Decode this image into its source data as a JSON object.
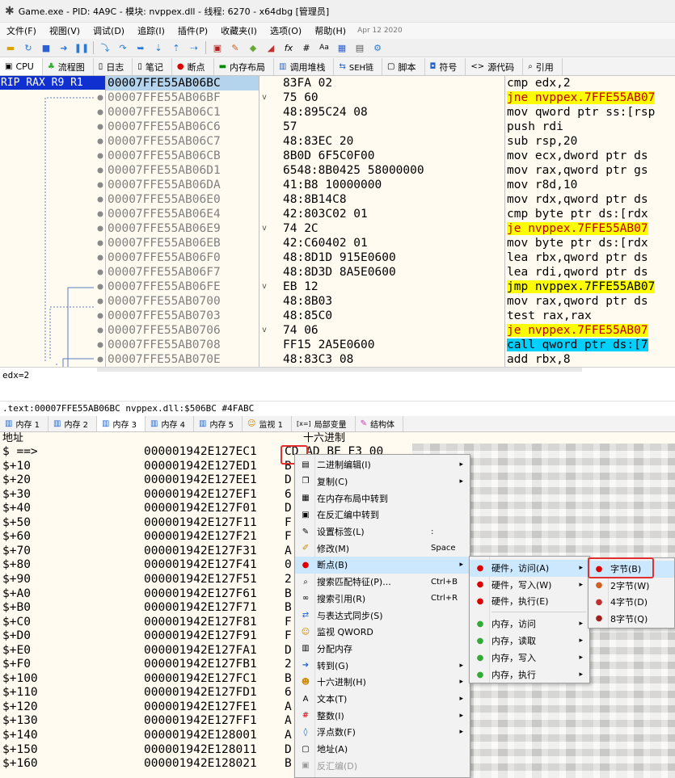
{
  "window": {
    "title": "Game.exe - PID: 4A9C - 模块: nvppex.dll - 线程: 6270 - x64dbg [管理员]"
  },
  "menubar": {
    "items": [
      "文件(F)",
      "视图(V)",
      "调试(D)",
      "追踪(I)",
      "插件(P)",
      "收藏夹(I)",
      "选项(O)",
      "帮助(H)"
    ],
    "date": "Apr 12 2020"
  },
  "cpu_tabs": [
    {
      "label": "CPU",
      "icon": "cpu-icon"
    },
    {
      "label": "流程图",
      "icon": "graph-icon"
    },
    {
      "label": "日志",
      "icon": "log-icon"
    },
    {
      "label": "笔记",
      "icon": "notes-icon"
    },
    {
      "label": "断点",
      "icon": "breakpoint-icon"
    },
    {
      "label": "内存布局",
      "icon": "memory-map-icon"
    },
    {
      "label": "调用堆栈",
      "icon": "callstack-icon"
    },
    {
      "label": "SEH链",
      "icon": "seh-icon"
    },
    {
      "label": "脚本",
      "icon": "script-icon"
    },
    {
      "label": "符号",
      "icon": "symbols-icon"
    },
    {
      "label": "源代码",
      "icon": "source-icon"
    },
    {
      "label": "引用",
      "icon": "references-icon"
    }
  ],
  "registers_label": "RIP RAX R9 R1",
  "disasm": [
    {
      "addr": "00007FFE55AB06BC",
      "bytes": "83FA 02",
      "instr": "cmp edx,2",
      "arrow": "",
      "hl": ""
    },
    {
      "addr": "00007FFE55AB06BF",
      "bytes": "75 60",
      "instr": "jne nvppex.7FFE55AB07",
      "arrow": "v",
      "hl": "jcc"
    },
    {
      "addr": "00007FFE55AB06C1",
      "bytes": "48:895C24 08",
      "instr": "mov qword ptr ss:[rsp",
      "arrow": "",
      "hl": ""
    },
    {
      "addr": "00007FFE55AB06C6",
      "bytes": "57",
      "instr": "push rdi",
      "arrow": "",
      "hl": ""
    },
    {
      "addr": "00007FFE55AB06C7",
      "bytes": "48:83EC 20",
      "instr": "sub rsp,20",
      "arrow": "",
      "hl": ""
    },
    {
      "addr": "00007FFE55AB06CB",
      "bytes": "8B0D 6F5C0F00",
      "instr": "mov ecx,dword ptr ds",
      "arrow": "",
      "hl": ""
    },
    {
      "addr": "00007FFE55AB06D1",
      "bytes": "6548:8B0425 58000000",
      "instr": "mov rax,qword ptr gs",
      "arrow": "",
      "hl": ""
    },
    {
      "addr": "00007FFE55AB06DA",
      "bytes": "41:B8 10000000",
      "instr": "mov r8d,10",
      "arrow": "",
      "hl": ""
    },
    {
      "addr": "00007FFE55AB06E0",
      "bytes": "48:8B14C8",
      "instr": "mov rdx,qword ptr ds",
      "arrow": "",
      "hl": ""
    },
    {
      "addr": "00007FFE55AB06E4",
      "bytes": "42:803C02 01",
      "instr": "cmp byte ptr ds:[rdx",
      "arrow": "",
      "hl": ""
    },
    {
      "addr": "00007FFE55AB06E9",
      "bytes": "74 2C",
      "instr": "je nvppex.7FFE55AB07",
      "arrow": "v",
      "hl": "jcc"
    },
    {
      "addr": "00007FFE55AB06EB",
      "bytes": "42:C60402 01",
      "instr": "mov byte ptr ds:[rdx",
      "arrow": "",
      "hl": ""
    },
    {
      "addr": "00007FFE55AB06F0",
      "bytes": "48:8D1D 915E0600",
      "instr": "lea rbx,qword ptr ds",
      "arrow": "",
      "hl": ""
    },
    {
      "addr": "00007FFE55AB06F7",
      "bytes": "48:8D3D 8A5E0600",
      "instr": "lea rdi,qword ptr ds",
      "arrow": "",
      "hl": ""
    },
    {
      "addr": "00007FFE55AB06FE",
      "bytes": "EB 12",
      "instr": "jmp nvppex.7FFE55AB07",
      "arrow": "v",
      "hl": "jmp"
    },
    {
      "addr": "00007FFE55AB0700",
      "bytes": "48:8B03",
      "instr": "mov rax,qword ptr ds",
      "arrow": "",
      "hl": ""
    },
    {
      "addr": "00007FFE55AB0703",
      "bytes": "48:85C0",
      "instr": "test rax,rax",
      "arrow": "",
      "hl": ""
    },
    {
      "addr": "00007FFE55AB0706",
      "bytes": "74 06",
      "instr": "je nvppex.7FFE55AB07",
      "arrow": "v",
      "hl": "jcc"
    },
    {
      "addr": "00007FFE55AB0708",
      "bytes": "FF15 2A5E0600",
      "instr": "call qword ptr ds:[7",
      "arrow": "",
      "hl": "call"
    },
    {
      "addr": "00007FFE55AB070E",
      "bytes": "48:83C3 08",
      "instr": "add rbx,8",
      "arrow": "",
      "hl": ""
    }
  ],
  "info_line": "edx=2",
  "location_line": ".text:00007FFE55AB06BC nvppex.dll:$506BC #4FABC",
  "dump_tabs": [
    {
      "label": "内存 1",
      "icon": "dump-icon"
    },
    {
      "label": "内存 2",
      "icon": "dump-icon"
    },
    {
      "label": "内存 3",
      "icon": "dump-icon"
    },
    {
      "label": "内存 4",
      "icon": "dump-icon"
    },
    {
      "label": "内存 5",
      "icon": "dump-icon"
    },
    {
      "label": "监视 1",
      "icon": "watch-icon"
    },
    {
      "label": "局部变量",
      "icon": "locals-icon"
    },
    {
      "label": "结构体",
      "icon": "struct-icon"
    }
  ],
  "dump_header": {
    "addr_col": "地址",
    "hex_col": "十六进制"
  },
  "dump_rows": [
    {
      "off": "$ ==>",
      "addr": "000001942E127EC1",
      "hex": "CD AD BE E3 00"
    },
    {
      "off": "$+10",
      "addr": "000001942E127ED1",
      "hex": "B"
    },
    {
      "off": "$+20",
      "addr": "000001942E127EE1",
      "hex": "D"
    },
    {
      "off": "$+30",
      "addr": "000001942E127EF1",
      "hex": "6"
    },
    {
      "off": "$+40",
      "addr": "000001942E127F01",
      "hex": "D"
    },
    {
      "off": "$+50",
      "addr": "000001942E127F11",
      "hex": "F"
    },
    {
      "off": "$+60",
      "addr": "000001942E127F21",
      "hex": "F"
    },
    {
      "off": "$+70",
      "addr": "000001942E127F31",
      "hex": "A"
    },
    {
      "off": "$+80",
      "addr": "000001942E127F41",
      "hex": "0"
    },
    {
      "off": "$+90",
      "addr": "000001942E127F51",
      "hex": "2"
    },
    {
      "off": "$+A0",
      "addr": "000001942E127F61",
      "hex": "B"
    },
    {
      "off": "$+B0",
      "addr": "000001942E127F71",
      "hex": "B"
    },
    {
      "off": "$+C0",
      "addr": "000001942E127F81",
      "hex": "F"
    },
    {
      "off": "$+D0",
      "addr": "000001942E127F91",
      "hex": "F"
    },
    {
      "off": "$+E0",
      "addr": "000001942E127FA1",
      "hex": "D"
    },
    {
      "off": "$+F0",
      "addr": "000001942E127FB1",
      "hex": "2"
    },
    {
      "off": "$+100",
      "addr": "000001942E127FC1",
      "hex": "B"
    },
    {
      "off": "$+110",
      "addr": "000001942E127FD1",
      "hex": "6"
    },
    {
      "off": "$+120",
      "addr": "000001942E127FE1",
      "hex": "A"
    },
    {
      "off": "$+130",
      "addr": "000001942E127FF1",
      "hex": "A"
    },
    {
      "off": "$+140",
      "addr": "000001942E128001",
      "hex": "A"
    },
    {
      "off": "$+150",
      "addr": "000001942E128011",
      "hex": "D"
    },
    {
      "off": "$+160",
      "addr": "000001942E128021",
      "hex": "B"
    }
  ],
  "context_menu": [
    {
      "label": "二进制编辑(I)",
      "shortcut": "",
      "arrow": "▸",
      "icon": "binary-edit-icon"
    },
    {
      "label": "复制(C)",
      "shortcut": "",
      "arrow": "▸",
      "icon": "copy-icon"
    },
    {
      "label": "在内存布局中转到",
      "shortcut": "",
      "arrow": "",
      "icon": "memory-map-icon"
    },
    {
      "label": "在反汇编中转到",
      "shortcut": "",
      "arrow": "",
      "icon": "disasm-icon"
    },
    {
      "label": "设置标签(L)",
      "shortcut": ":",
      "arrow": "",
      "icon": "label-icon"
    },
    {
      "label": "修改(M)",
      "shortcut": "Space",
      "arrow": "",
      "icon": "modify-icon"
    },
    {
      "label": "断点(B)",
      "shortcut": "",
      "arrow": "▸",
      "icon": "breakpoint-icon"
    },
    {
      "label": "搜索匹配特征(P)...",
      "shortcut": "Ctrl+B",
      "arrow": "",
      "icon": "search-pattern-icon"
    },
    {
      "label": "搜索引用(R)",
      "shortcut": "Ctrl+R",
      "arrow": "",
      "icon": "binoculars-icon"
    },
    {
      "label": "与表达式同步(S)",
      "shortcut": "",
      "arrow": "",
      "icon": "sync-icon"
    },
    {
      "label": "监视 QWORD",
      "shortcut": "",
      "arrow": "",
      "icon": "watch-icon"
    },
    {
      "label": "分配内存",
      "shortcut": "",
      "arrow": "",
      "icon": "alloc-icon"
    },
    {
      "label": "转到(G)",
      "shortcut": "",
      "arrow": "▸",
      "icon": "goto-icon"
    },
    {
      "label": "十六进制(H)",
      "shortcut": "",
      "arrow": "▸",
      "icon": "hex-icon"
    },
    {
      "label": "文本(T)",
      "shortcut": "",
      "arrow": "▸",
      "icon": "text-icon"
    },
    {
      "label": "整数(I)",
      "shortcut": "",
      "arrow": "▸",
      "icon": "integer-icon"
    },
    {
      "label": "浮点数(F)",
      "shortcut": "",
      "arrow": "▸",
      "icon": "float-icon"
    },
    {
      "label": "地址(A)",
      "shortcut": "",
      "arrow": "",
      "icon": "address-icon"
    },
    {
      "label": "反汇编(D)",
      "shortcut": "",
      "arrow": "",
      "icon": "disasm-icon"
    }
  ],
  "breakpoint_submenu": [
    {
      "label": "硬件，访问(A)",
      "arrow": "▸"
    },
    {
      "label": "硬件，写入(W)",
      "arrow": "▸"
    },
    {
      "label": "硬件，执行(E)",
      "arrow": ""
    },
    {
      "label": "内存，访问",
      "arrow": "▸"
    },
    {
      "label": "内存，读取",
      "arrow": "▸"
    },
    {
      "label": "内存，写入",
      "arrow": "▸"
    },
    {
      "label": "内存，执行",
      "arrow": "▸"
    }
  ],
  "hw_access_submenu": [
    {
      "label": "字节(B)"
    },
    {
      "label": "2字节(W)"
    },
    {
      "label": "4字节(D)"
    },
    {
      "label": "8字节(Q)"
    }
  ],
  "colors": {
    "selection": "#cce8ff",
    "highlight_box": "#e03030",
    "reg_box": "#1030d0",
    "jcc_bg": "#ffff00",
    "jcc_fg": "#c00000",
    "call_bg": "#00d0ff"
  }
}
